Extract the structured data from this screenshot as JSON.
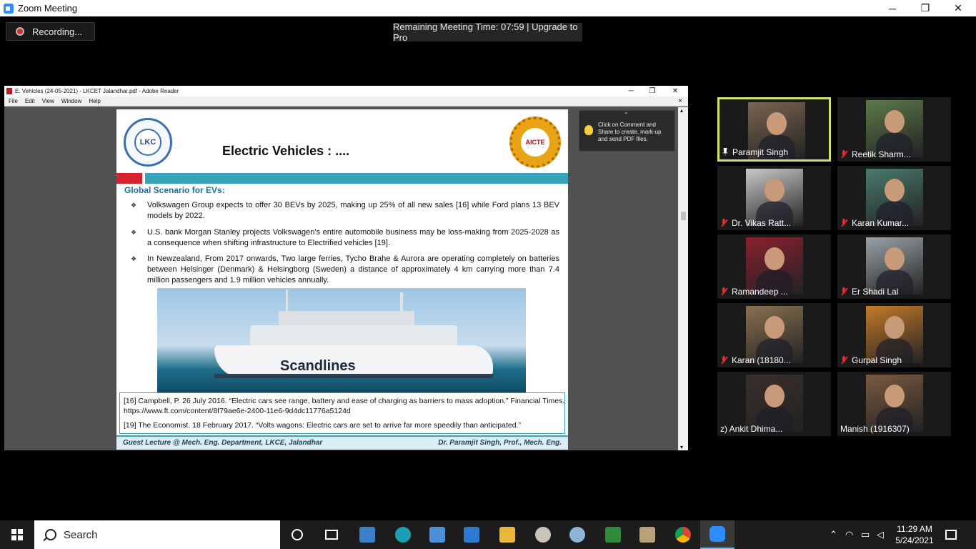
{
  "zoom": {
    "window_title": "Zoom Meeting",
    "recording_label": "Recording...",
    "remaining_time": "Remaining Meeting Time: 07:59 | Upgrade to Pro",
    "controls": {
      "minimize": "─",
      "restore": "❐",
      "close": "✕"
    }
  },
  "reader": {
    "title": "E. Vehicles (24-05-2021) - LKCET Jalandhar.pdf - Adobe Reader",
    "menu": [
      "File",
      "Edit",
      "View",
      "Window",
      "Help"
    ],
    "close_doc": "×",
    "comment_tip": "Click on Comment and Share to create, mark-up and send PDF files."
  },
  "slide": {
    "title": "Electric Vehicles : ....",
    "lkc_logo_text": "LKC",
    "aicte_logo_text": "AICTE",
    "section_heading": "Global Scenario for EVs:",
    "bullets": [
      "Volkswagen Group expects to offer 30 BEVs by 2025, making up 25% of all new sales [16] while Ford plans 13 BEV models by 2022.",
      "U.S. bank Morgan Stanley projects Volkswagen's entire automobile business may be loss-making from 2025-2028 as a consequence when shifting infrastructure to Electrified vehicles [19].",
      "In Newzealand, From 2017 onwards, Two large ferries, Tycho Brahe & Aurora are operating completely on batteries between Helsinger (Denmark) & Helsingborg (Sweden) a distance of approximately 4 km carrying more than 7.4 million passengers and 1.9 million vehicles annually."
    ],
    "ship_brand": "Scandlines",
    "references": [
      "[16] Campbell, P. 26 July 2016. “Electric cars see range, battery and ease of charging as barriers to mass adoption.” Financial Times. https://www.ft.com/content/8f79ae6e-2400-11e6-9d4dc11776a5124d",
      "[19] The Economist. 18 February 2017. “Volts wagons: Electric cars are set to arrive far more speedily than anticipated.”"
    ],
    "footer_left": "Guest Lecture @ Mech. Eng. Department, LKCE, Jalandhar",
    "footer_right": "Dr. Paramjit Singh, Prof., Mech. Eng."
  },
  "participants": [
    {
      "name": "Paramjit Singh",
      "icon": "pin-icon",
      "active": true,
      "color": "#7a6550"
    },
    {
      "name": "Reetik Sharm...",
      "icon": "mic-muted-icon",
      "color": "#5d7a4a"
    },
    {
      "name": "Dr. Vikas Ratt...",
      "icon": "mic-muted-icon",
      "color": "#c9c9c9"
    },
    {
      "name": "Karan Kumar...",
      "icon": "mic-muted-icon",
      "color": "#4a7a6e"
    },
    {
      "name": "Ramandeep ...",
      "icon": "mic-muted-icon",
      "color": "#8a1f2f"
    },
    {
      "name": "Er Shadi Lal",
      "icon": "mic-muted-icon",
      "color": "#9aa3a8"
    },
    {
      "name": "Karan (18180...",
      "icon": "mic-muted-icon",
      "color": "#8a7050"
    },
    {
      "name": "Gurpal Singh",
      "icon": "mic-muted-icon",
      "color": "#c57a2a"
    },
    {
      "name": "z)   Ankit Dhima...",
      "icon": "none",
      "color": "#3a2f2a"
    },
    {
      "name": "Manish (1916307)",
      "icon": "none",
      "color": "#7a5a40"
    }
  ],
  "taskbar": {
    "search_placeholder": "Search",
    "time": "11:29 AM",
    "date": "5/24/2021"
  },
  "colors": {
    "zoom_blue": "#2d8cff",
    "active_speaker_border": "#d6e16a",
    "muted_red": "#e02a2a",
    "slide_teal": "#37a3b8"
  }
}
